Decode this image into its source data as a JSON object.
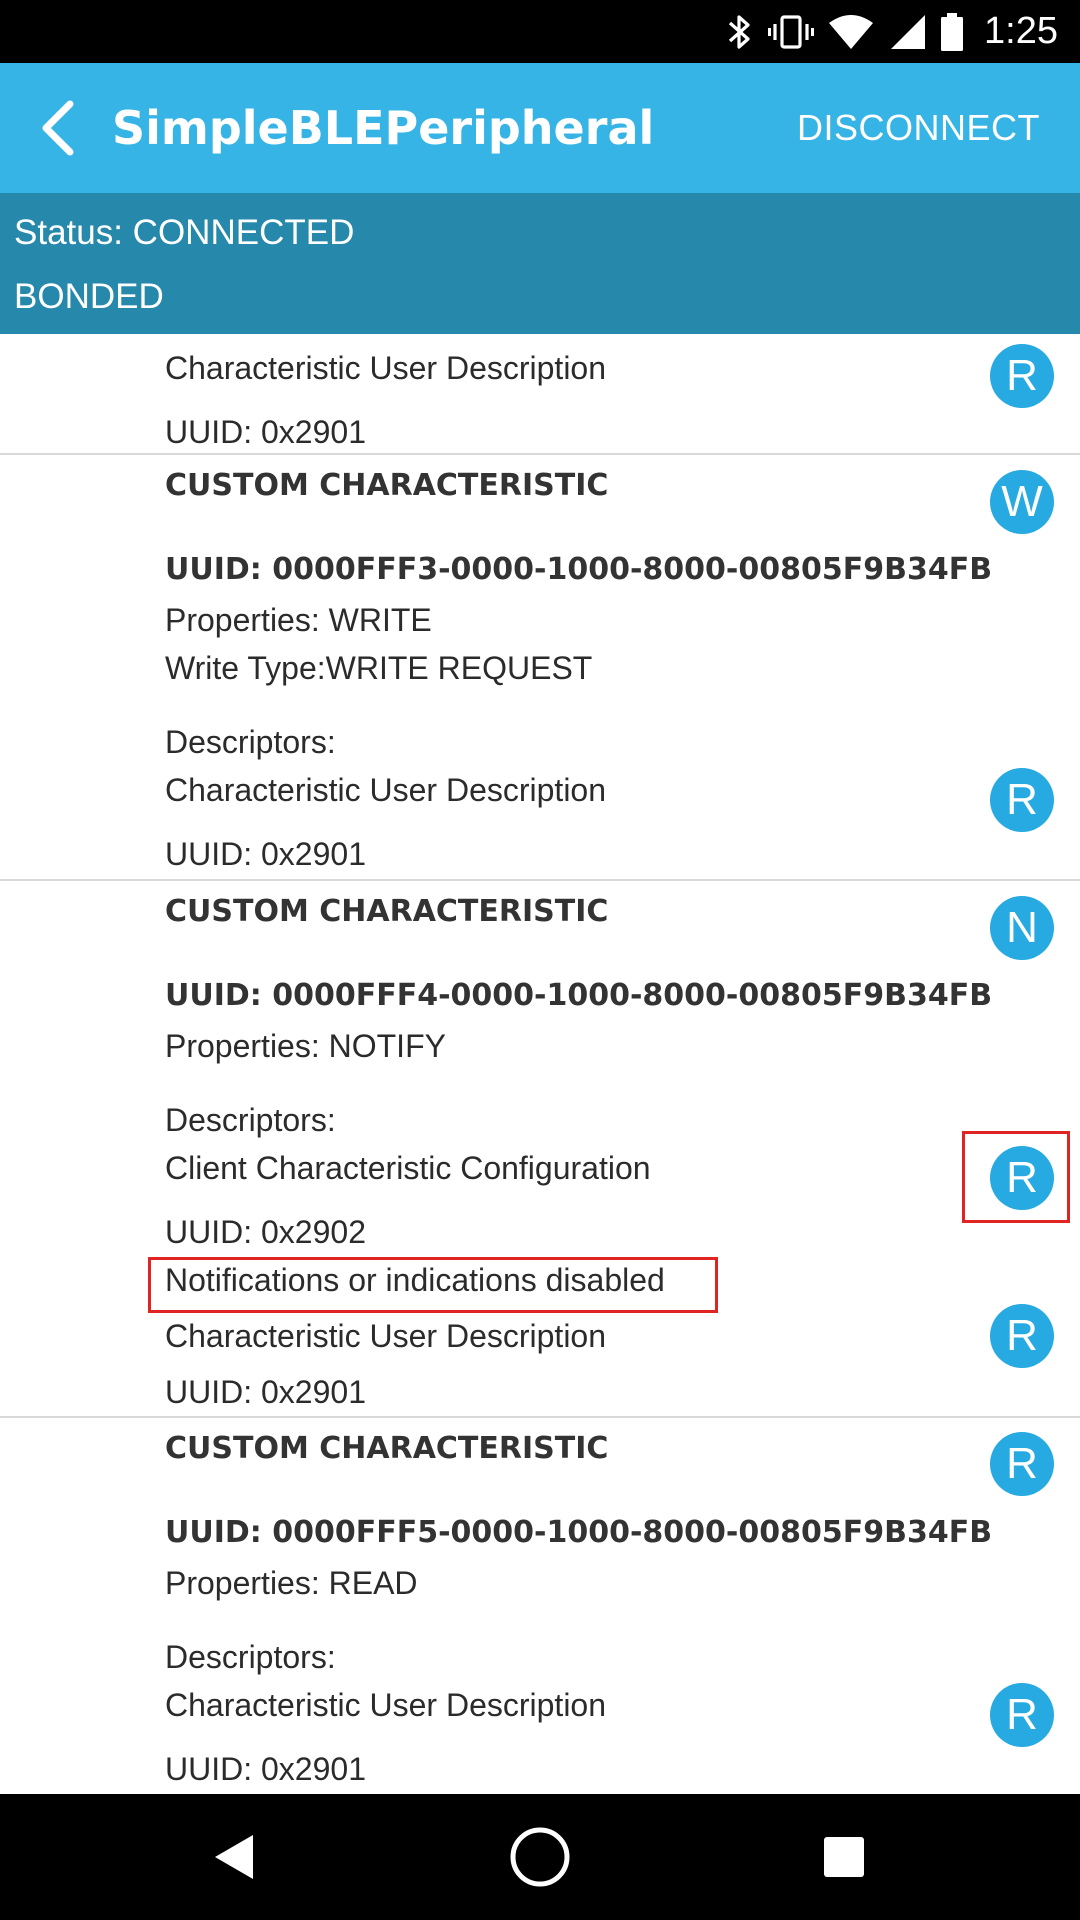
{
  "status_bar": {
    "time": "1:25",
    "icons": [
      "bluetooth-icon",
      "vibrate-icon",
      "wifi-icon",
      "cell-signal-icon",
      "battery-icon"
    ]
  },
  "app_bar": {
    "title": "SimpleBLEPeripheral",
    "action": "DISCONNECT",
    "color": "#36b4e5"
  },
  "status_panel": {
    "status": "Status: CONNECTED",
    "bond": "BONDED",
    "color": "#2688ab"
  },
  "list": {
    "top_partial": {
      "desc_name": "Characteristic User Description",
      "desc_uuid": "UUID: 0x2901",
      "badge": "R"
    },
    "char_fff3": {
      "title": "CUSTOM CHARACTERISTIC",
      "badge": "W",
      "uuid": "UUID: 0000FFF3-0000-1000-8000-00805F9B34FB",
      "properties": "Properties: WRITE",
      "write_type": "Write Type:WRITE REQUEST",
      "descriptors_label": "Descriptors:",
      "desc_name": "Characteristic User Description",
      "desc_badge": "R",
      "desc_uuid": "UUID: 0x2901"
    },
    "char_fff4": {
      "title": "CUSTOM CHARACTERISTIC",
      "badge": "N",
      "uuid": "UUID: 0000FFF4-0000-1000-8000-00805F9B34FB",
      "properties": "Properties: NOTIFY",
      "descriptors_label": "Descriptors:",
      "desc1_name": "Client Characteristic Configuration",
      "desc1_badge": "R",
      "desc1_uuid": "UUID: 0x2902",
      "desc1_value": "Notifications or indications disabled",
      "desc2_name": "Characteristic User Description",
      "desc2_badge": "R",
      "desc2_uuid": "UUID: 0x2901"
    },
    "char_fff5": {
      "title": "CUSTOM CHARACTERISTIC",
      "badge": "R",
      "uuid": "UUID: 0000FFF5-0000-1000-8000-00805F9B34FB",
      "properties": "Properties: READ",
      "descriptors_label": "Descriptors:",
      "desc_name": "Characteristic User Description",
      "desc_badge": "R",
      "desc_uuid": "UUID: 0x2901"
    }
  },
  "nav_bar": {
    "icons": [
      "back-triangle-icon",
      "home-circle-icon",
      "recents-square-icon"
    ]
  },
  "colors": {
    "badge": "#27a9e1",
    "highlight": "#e02424"
  }
}
